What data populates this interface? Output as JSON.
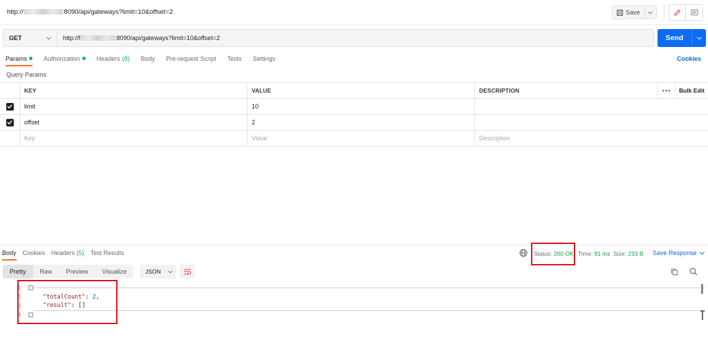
{
  "header": {
    "request_title_prefix": "http://",
    "request_title_suffix": ":8090/api/gateways?limit=10&offset=2",
    "save_label": "Save"
  },
  "request": {
    "method": "GET",
    "url_prefix": "http://f",
    "url_suffix": ":8090/api/gateways?limit=10&offset=2",
    "send_label": "Send"
  },
  "request_tabs": [
    {
      "label": "Params",
      "dot": true
    },
    {
      "label": "Authorization",
      "dot": true
    },
    {
      "label": "Headers",
      "count": "(8)"
    },
    {
      "label": "Body"
    },
    {
      "label": "Pre-request Script"
    },
    {
      "label": "Tests"
    },
    {
      "label": "Settings"
    }
  ],
  "cookies_label": "Cookies",
  "query_params_label": "Query Params",
  "params_table": {
    "headers": {
      "key": "KEY",
      "value": "VALUE",
      "description": "DESCRIPTION",
      "more": "•••",
      "bulk_edit": "Bulk Edit"
    },
    "rows": [
      {
        "key": "limit",
        "value": "10",
        "checked": true
      },
      {
        "key": "offset",
        "value": "2",
        "checked": true
      }
    ],
    "placeholders": {
      "key": "Key",
      "value": "Value",
      "description": "Description"
    }
  },
  "response_tabs": [
    {
      "label": "Body"
    },
    {
      "label": "Cookies"
    },
    {
      "label": "Headers",
      "count": "(5)"
    },
    {
      "label": "Test Results"
    }
  ],
  "response_meta": {
    "status_label": "Status:",
    "status_value": "200 OK",
    "time_label": "Time:",
    "time_value": "91 ms",
    "size_label": "Size:",
    "size_value": "233 B",
    "save_response_label": "Save Response"
  },
  "format_tabs": [
    "Pretty",
    "Raw",
    "Preview",
    "Visualize"
  ],
  "format_select": "JSON",
  "response_body": {
    "gutter": [
      "1",
      "2",
      "3",
      "4"
    ],
    "line2_key": "\"totalCount\"",
    "line2_sep": ": ",
    "line2_value": "2",
    "line2_end": ",",
    "line3_key": "\"result\"",
    "line3_sep": ": ",
    "line3_value": "[]"
  },
  "colors": {
    "accent": "#ff6c37",
    "send": "#0c6cf2",
    "link": "#0b66d6",
    "ok": "#0a9c45",
    "highlight": "#d9171c"
  }
}
